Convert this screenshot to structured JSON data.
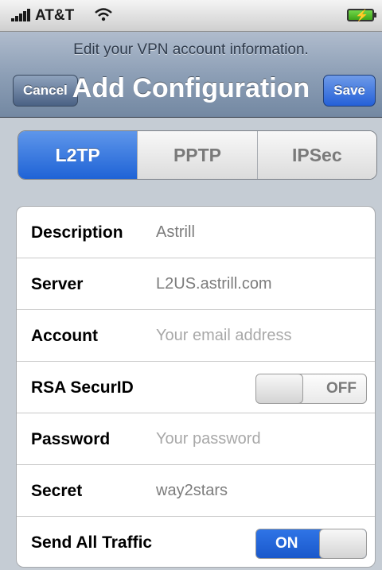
{
  "status_bar": {
    "carrier": "AT&T"
  },
  "nav": {
    "prompt": "Edit your VPN account information.",
    "title": "Add Configuration",
    "cancel_label": "Cancel",
    "save_label": "Save"
  },
  "segments": {
    "items": [
      "L2TP",
      "PPTP",
      "IPSec"
    ],
    "selected": "L2TP"
  },
  "form": {
    "description": {
      "label": "Description",
      "value": "Astrill"
    },
    "server": {
      "label": "Server",
      "value": "L2US.astrill.com"
    },
    "account": {
      "label": "Account",
      "placeholder": "Your email address"
    },
    "rsa_securid": {
      "label": "RSA SecurID",
      "state": "OFF"
    },
    "password": {
      "label": "Password",
      "placeholder": "Your password"
    },
    "secret": {
      "label": "Secret",
      "value": "way2stars"
    },
    "send_all_traffic": {
      "label": "Send All Traffic",
      "state": "ON"
    }
  },
  "colors": {
    "accent_blue": "#1f63d6",
    "nav_bar": "#8d9fb6",
    "background": "#c5ccd4"
  }
}
